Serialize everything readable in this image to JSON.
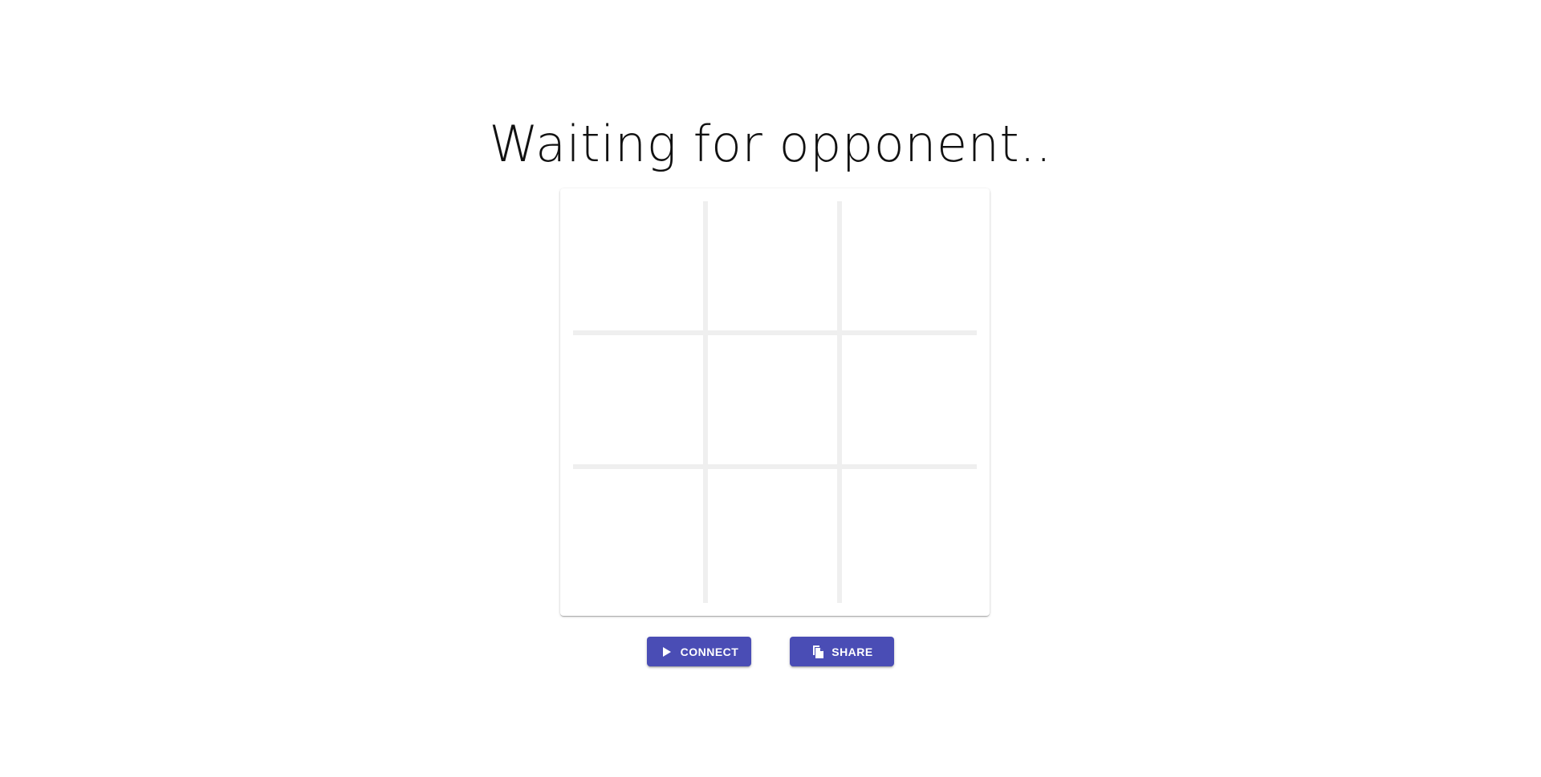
{
  "status": {
    "title": "Waiting for opponent.."
  },
  "board": {
    "cells": [
      "",
      "",
      "",
      "",
      "",
      "",
      "",
      "",
      ""
    ]
  },
  "actions": {
    "connect_label": "CONNECT",
    "connect_icon": "play-icon",
    "share_label": "SHARE",
    "share_icon": "copy-icon"
  },
  "colors": {
    "primary": "#4a4db5",
    "grid_line": "#efefef",
    "title_text": "#111111"
  }
}
